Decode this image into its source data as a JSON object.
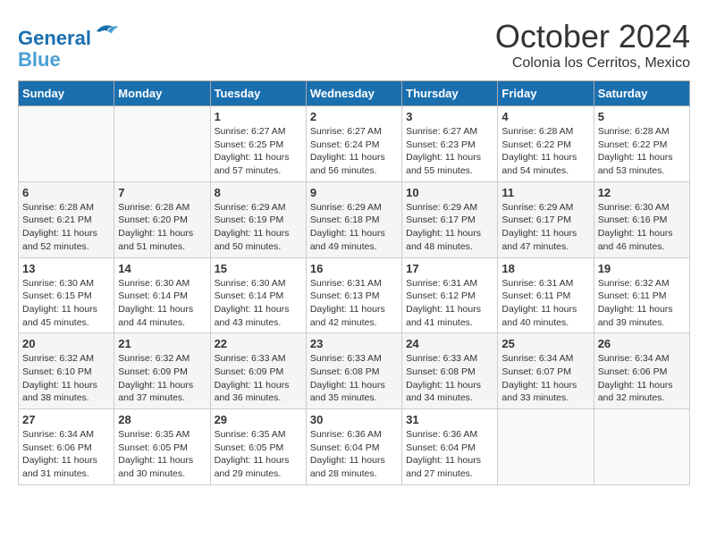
{
  "header": {
    "logo_line1": "General",
    "logo_line2": "Blue",
    "month": "October 2024",
    "location": "Colonia los Cerritos, Mexico"
  },
  "weekdays": [
    "Sunday",
    "Monday",
    "Tuesday",
    "Wednesday",
    "Thursday",
    "Friday",
    "Saturday"
  ],
  "weeks": [
    [
      {
        "day": "",
        "info": ""
      },
      {
        "day": "",
        "info": ""
      },
      {
        "day": "1",
        "info": "Sunrise: 6:27 AM\nSunset: 6:25 PM\nDaylight: 11 hours and 57 minutes."
      },
      {
        "day": "2",
        "info": "Sunrise: 6:27 AM\nSunset: 6:24 PM\nDaylight: 11 hours and 56 minutes."
      },
      {
        "day": "3",
        "info": "Sunrise: 6:27 AM\nSunset: 6:23 PM\nDaylight: 11 hours and 55 minutes."
      },
      {
        "day": "4",
        "info": "Sunrise: 6:28 AM\nSunset: 6:22 PM\nDaylight: 11 hours and 54 minutes."
      },
      {
        "day": "5",
        "info": "Sunrise: 6:28 AM\nSunset: 6:22 PM\nDaylight: 11 hours and 53 minutes."
      }
    ],
    [
      {
        "day": "6",
        "info": "Sunrise: 6:28 AM\nSunset: 6:21 PM\nDaylight: 11 hours and 52 minutes."
      },
      {
        "day": "7",
        "info": "Sunrise: 6:28 AM\nSunset: 6:20 PM\nDaylight: 11 hours and 51 minutes."
      },
      {
        "day": "8",
        "info": "Sunrise: 6:29 AM\nSunset: 6:19 PM\nDaylight: 11 hours and 50 minutes."
      },
      {
        "day": "9",
        "info": "Sunrise: 6:29 AM\nSunset: 6:18 PM\nDaylight: 11 hours and 49 minutes."
      },
      {
        "day": "10",
        "info": "Sunrise: 6:29 AM\nSunset: 6:17 PM\nDaylight: 11 hours and 48 minutes."
      },
      {
        "day": "11",
        "info": "Sunrise: 6:29 AM\nSunset: 6:17 PM\nDaylight: 11 hours and 47 minutes."
      },
      {
        "day": "12",
        "info": "Sunrise: 6:30 AM\nSunset: 6:16 PM\nDaylight: 11 hours and 46 minutes."
      }
    ],
    [
      {
        "day": "13",
        "info": "Sunrise: 6:30 AM\nSunset: 6:15 PM\nDaylight: 11 hours and 45 minutes."
      },
      {
        "day": "14",
        "info": "Sunrise: 6:30 AM\nSunset: 6:14 PM\nDaylight: 11 hours and 44 minutes."
      },
      {
        "day": "15",
        "info": "Sunrise: 6:30 AM\nSunset: 6:14 PM\nDaylight: 11 hours and 43 minutes."
      },
      {
        "day": "16",
        "info": "Sunrise: 6:31 AM\nSunset: 6:13 PM\nDaylight: 11 hours and 42 minutes."
      },
      {
        "day": "17",
        "info": "Sunrise: 6:31 AM\nSunset: 6:12 PM\nDaylight: 11 hours and 41 minutes."
      },
      {
        "day": "18",
        "info": "Sunrise: 6:31 AM\nSunset: 6:11 PM\nDaylight: 11 hours and 40 minutes."
      },
      {
        "day": "19",
        "info": "Sunrise: 6:32 AM\nSunset: 6:11 PM\nDaylight: 11 hours and 39 minutes."
      }
    ],
    [
      {
        "day": "20",
        "info": "Sunrise: 6:32 AM\nSunset: 6:10 PM\nDaylight: 11 hours and 38 minutes."
      },
      {
        "day": "21",
        "info": "Sunrise: 6:32 AM\nSunset: 6:09 PM\nDaylight: 11 hours and 37 minutes."
      },
      {
        "day": "22",
        "info": "Sunrise: 6:33 AM\nSunset: 6:09 PM\nDaylight: 11 hours and 36 minutes."
      },
      {
        "day": "23",
        "info": "Sunrise: 6:33 AM\nSunset: 6:08 PM\nDaylight: 11 hours and 35 minutes."
      },
      {
        "day": "24",
        "info": "Sunrise: 6:33 AM\nSunset: 6:08 PM\nDaylight: 11 hours and 34 minutes."
      },
      {
        "day": "25",
        "info": "Sunrise: 6:34 AM\nSunset: 6:07 PM\nDaylight: 11 hours and 33 minutes."
      },
      {
        "day": "26",
        "info": "Sunrise: 6:34 AM\nSunset: 6:06 PM\nDaylight: 11 hours and 32 minutes."
      }
    ],
    [
      {
        "day": "27",
        "info": "Sunrise: 6:34 AM\nSunset: 6:06 PM\nDaylight: 11 hours and 31 minutes."
      },
      {
        "day": "28",
        "info": "Sunrise: 6:35 AM\nSunset: 6:05 PM\nDaylight: 11 hours and 30 minutes."
      },
      {
        "day": "29",
        "info": "Sunrise: 6:35 AM\nSunset: 6:05 PM\nDaylight: 11 hours and 29 minutes."
      },
      {
        "day": "30",
        "info": "Sunrise: 6:36 AM\nSunset: 6:04 PM\nDaylight: 11 hours and 28 minutes."
      },
      {
        "day": "31",
        "info": "Sunrise: 6:36 AM\nSunset: 6:04 PM\nDaylight: 11 hours and 27 minutes."
      },
      {
        "day": "",
        "info": ""
      },
      {
        "day": "",
        "info": ""
      }
    ]
  ]
}
